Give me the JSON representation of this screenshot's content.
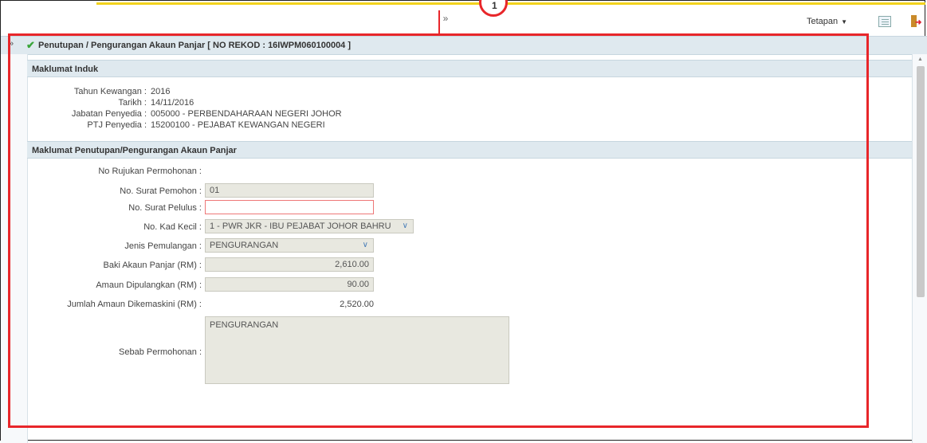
{
  "header": {
    "settings_label": "Tetapan",
    "collapse_icon": "double-chevron-up-icon",
    "annotation_number": "1"
  },
  "title": {
    "text": "Penutupan / Pengurangan Akaun Panjar [ NO REKOD : 16IWPM060100004 ]"
  },
  "section_induk": {
    "heading": "Maklumat Induk",
    "rows": [
      {
        "label": "Tahun Kewangan :",
        "value": "2016"
      },
      {
        "label": "Tarikh :",
        "value": "14/11/2016"
      },
      {
        "label": "Jabatan Penyedia :",
        "value": "005000 - PERBENDAHARAAN NEGERI JOHOR"
      },
      {
        "label": "PTJ Penyedia :",
        "value": "15200100 - PEJABAT KEWANGAN NEGERI"
      }
    ]
  },
  "section_penutupan": {
    "heading": "Maklumat Penutupan/Pengurangan Akaun Panjar",
    "no_rujukan_label": "No Rujukan Permohonan :",
    "no_surat_pemohon_label": "No. Surat Pemohon :",
    "no_surat_pemohon_value": "01",
    "no_surat_pelulus_label": "No. Surat Pelulus :",
    "no_surat_pelulus_value": "",
    "no_kad_kecil_label": "No. Kad Kecil :",
    "no_kad_kecil_value": "1 - PWR JKR - IBU PEJABAT JOHOR BAHRU",
    "jenis_pemulangan_label": "Jenis Pemulangan :",
    "jenis_pemulangan_value": "PENGURANGAN",
    "baki_label": "Baki Akaun Panjar (RM) :",
    "baki_value": "2,610.00",
    "amaun_label": "Amaun Dipulangkan (RM) :",
    "amaun_value": "90.00",
    "jumlah_label": "Jumlah Amaun Dikemaskini (RM) :",
    "jumlah_value": "2,520.00",
    "sebab_label": "Sebab Permohonan :",
    "sebab_value": "PENGURANGAN"
  },
  "colors": {
    "accent_yellow": "#f2d21c",
    "annotation_red": "#e8262a",
    "section_bg": "#dfe9ef"
  }
}
